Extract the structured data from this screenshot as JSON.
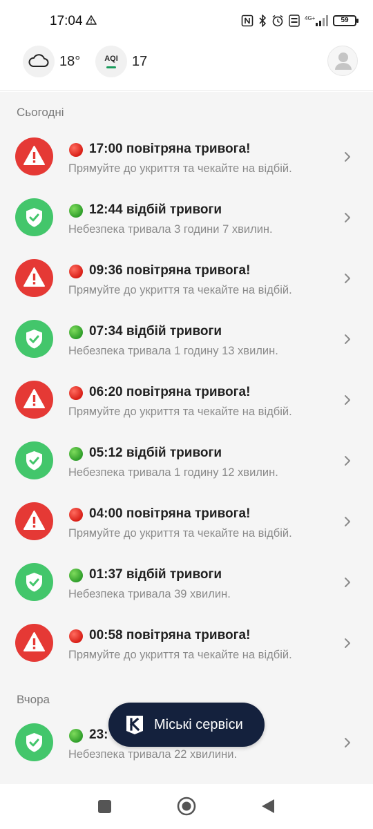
{
  "status_bar": {
    "time": "17:04",
    "battery": "59",
    "icons": [
      "alert-triangle-icon",
      "nfc-icon",
      "bluetooth-icon",
      "alarm-icon",
      "volte-icon",
      "signal-4g-icon",
      "battery-icon"
    ]
  },
  "header": {
    "temperature": "18°",
    "aqi_label": "AQI",
    "aqi_value": "17",
    "aqi_color": "#1a9b5c"
  },
  "sections": {
    "today": "Сьогодні",
    "yesterday": "Вчора"
  },
  "items": [
    {
      "type": "alarm",
      "title": "17:00 повітряна тривога!",
      "subtitle": "Прямуйте до укриття та чекайте на відбій."
    },
    {
      "type": "clear",
      "title": "12:44 відбій тривоги",
      "subtitle": "Небезпека тривала 3 години 7 хвилин."
    },
    {
      "type": "alarm",
      "title": "09:36 повітряна тривога!",
      "subtitle": "Прямуйте до укриття та чекайте на відбій."
    },
    {
      "type": "clear",
      "title": "07:34 відбій тривоги",
      "subtitle": "Небезпека тривала 1 годину 13 хвилин."
    },
    {
      "type": "alarm",
      "title": "06:20 повітряна тривога!",
      "subtitle": "Прямуйте до укриття та чекайте на відбій."
    },
    {
      "type": "clear",
      "title": "05:12 відбій тривоги",
      "subtitle": "Небезпека тривала 1 годину 12 хвилин."
    },
    {
      "type": "alarm",
      "title": "04:00 повітряна тривога!",
      "subtitle": "Прямуйте до укриття та чекайте на відбій."
    },
    {
      "type": "clear",
      "title": "01:37 відбій тривоги",
      "subtitle": "Небезпека тривала 39 хвилин."
    },
    {
      "type": "alarm",
      "title": "00:58 повітряна тривога!",
      "subtitle": "Прямуйте до укриття та чекайте на відбій."
    },
    {
      "type": "clear",
      "title": "23:",
      "subtitle": "Небезпека тривала 22 хвилини."
    }
  ],
  "fab": {
    "label": "Міські сервіси",
    "background": "#14213d"
  },
  "colors": {
    "alarm": "#e53935",
    "clear": "#43c66b"
  }
}
